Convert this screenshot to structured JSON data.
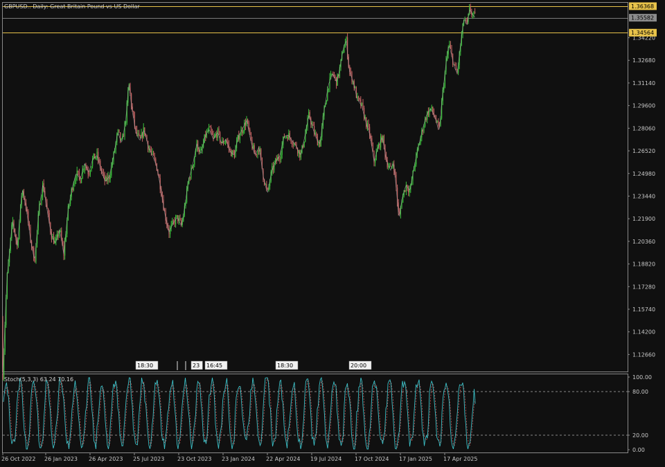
{
  "header": {
    "title": "GBPUSD.. Daily:  Great Britain Pound vs US Dollar"
  },
  "price_panel": {
    "hlines": [
      {
        "label": "1.36368",
        "value": 1.36368,
        "color": "#e8c34a",
        "label_bg": "#e8c34a",
        "label_fg": "#000000"
      },
      {
        "label": "1.35582",
        "value": 1.35582,
        "color": "#7a7a7a",
        "label_bg": "#8c8c8c",
        "label_fg": "#000000"
      },
      {
        "label": "1.34564",
        "value": 1.34564,
        "color": "#e8c34a",
        "label_bg": "#e8c34a",
        "label_fg": "#000000"
      }
    ],
    "y_ticks": [
      "1.34220",
      "1.32680",
      "1.31140",
      "1.29600",
      "1.28060",
      "1.26520",
      "1.24980",
      "1.23440",
      "1.21900",
      "1.20360",
      "1.18820",
      "1.17280",
      "1.15740",
      "1.14200",
      "1.12660"
    ],
    "event_markers": [
      "18:30",
      "",
      "",
      "23",
      "16:45",
      "18:30",
      "20:00"
    ],
    "colors": {
      "up": "#3cc43c",
      "down": "#c86464",
      "ma": "#b0b0b0",
      "background": "#101010",
      "grid": "#808080"
    }
  },
  "stoch_panel": {
    "label": "Stoch(5,3,3) 63.24 70.16",
    "y_ticks": [
      "100.00",
      "80.00",
      "20.00",
      "0.00"
    ],
    "levels": [
      80,
      20
    ],
    "colors": {
      "main": "#3bbfc6",
      "signal": "#d05a5a"
    }
  },
  "x_axis": {
    "ticks": [
      "26 Oct 2022",
      "26 Jan 2023",
      "26 Apr 2023",
      "25 Jul 2023",
      "23 Oct 2023",
      "23 Jan 2024",
      "22 Apr 2024",
      "19 Jul 2024",
      "17 Oct 2024",
      "17 Jan 2025",
      "17 Apr 2025"
    ]
  },
  "chart_data": {
    "type": "candlestick",
    "title": "GBPUSD.. Daily:  Great Britain Pound vs US Dollar",
    "ylim": [
      1.115,
      1.366
    ],
    "x_range": [
      "26 Oct 2022",
      "Jun 2025"
    ],
    "close_path": [
      [
        0,
        1.15
      ],
      [
        4,
        1.113
      ],
      [
        10,
        1.178
      ],
      [
        18,
        1.218
      ],
      [
        25,
        1.2
      ],
      [
        32,
        1.24
      ],
      [
        38,
        1.226
      ],
      [
        44,
        1.205
      ],
      [
        50,
        1.19
      ],
      [
        56,
        1.224
      ],
      [
        62,
        1.243
      ],
      [
        68,
        1.225
      ],
      [
        74,
        1.208
      ],
      [
        80,
        1.202
      ],
      [
        86,
        1.212
      ],
      [
        92,
        1.195
      ],
      [
        98,
        1.224
      ],
      [
        104,
        1.24
      ],
      [
        110,
        1.25
      ],
      [
        116,
        1.246
      ],
      [
        122,
        1.257
      ],
      [
        128,
        1.25
      ],
      [
        134,
        1.26
      ],
      [
        140,
        1.262
      ],
      [
        146,
        1.252
      ],
      [
        152,
        1.244
      ],
      [
        158,
        1.248
      ],
      [
        164,
        1.262
      ],
      [
        170,
        1.278
      ],
      [
        176,
        1.27
      ],
      [
        182,
        1.288
      ],
      [
        186,
        1.312
      ],
      [
        190,
        1.295
      ],
      [
        196,
        1.278
      ],
      [
        202,
        1.272
      ],
      [
        208,
        1.28
      ],
      [
        214,
        1.268
      ],
      [
        220,
        1.262
      ],
      [
        226,
        1.255
      ],
      [
        232,
        1.24
      ],
      [
        238,
        1.222
      ],
      [
        244,
        1.21
      ],
      [
        250,
        1.216
      ],
      [
        256,
        1.22
      ],
      [
        262,
        1.214
      ],
      [
        266,
        1.225
      ],
      [
        272,
        1.245
      ],
      [
        278,
        1.255
      ],
      [
        284,
        1.27
      ],
      [
        290,
        1.263
      ],
      [
        296,
        1.275
      ],
      [
        302,
        1.28
      ],
      [
        308,
        1.273
      ],
      [
        314,
        1.278
      ],
      [
        320,
        1.27
      ],
      [
        326,
        1.273
      ],
      [
        332,
        1.265
      ],
      [
        338,
        1.262
      ],
      [
        344,
        1.275
      ],
      [
        350,
        1.28
      ],
      [
        356,
        1.286
      ],
      [
        362,
        1.272
      ],
      [
        368,
        1.262
      ],
      [
        374,
        1.268
      ],
      [
        380,
        1.248
      ],
      [
        386,
        1.236
      ],
      [
        392,
        1.251
      ],
      [
        398,
        1.258
      ],
      [
        404,
        1.262
      ],
      [
        410,
        1.275
      ],
      [
        416,
        1.276
      ],
      [
        422,
        1.272
      ],
      [
        428,
        1.268
      ],
      [
        434,
        1.262
      ],
      [
        440,
        1.275
      ],
      [
        446,
        1.29
      ],
      [
        452,
        1.28
      ],
      [
        458,
        1.272
      ],
      [
        462,
        1.27
      ],
      [
        468,
        1.293
      ],
      [
        474,
        1.31
      ],
      [
        480,
        1.318
      ],
      [
        486,
        1.312
      ],
      [
        490,
        1.32
      ],
      [
        496,
        1.336
      ],
      [
        500,
        1.34
      ],
      [
        504,
        1.32
      ],
      [
        510,
        1.312
      ],
      [
        516,
        1.3
      ],
      [
        522,
        1.296
      ],
      [
        528,
        1.285
      ],
      [
        534,
        1.276
      ],
      [
        540,
        1.258
      ],
      [
        546,
        1.268
      ],
      [
        552,
        1.275
      ],
      [
        558,
        1.258
      ],
      [
        564,
        1.252
      ],
      [
        568,
        1.258
      ],
      [
        572,
        1.24
      ],
      [
        576,
        1.218
      ],
      [
        580,
        1.232
      ],
      [
        586,
        1.242
      ],
      [
        592,
        1.238
      ],
      [
        598,
        1.255
      ],
      [
        604,
        1.268
      ],
      [
        610,
        1.28
      ],
      [
        616,
        1.29
      ],
      [
        622,
        1.294
      ],
      [
        628,
        1.288
      ],
      [
        634,
        1.278
      ],
      [
        638,
        1.3
      ],
      [
        644,
        1.325
      ],
      [
        648,
        1.338
      ],
      [
        652,
        1.33
      ],
      [
        656,
        1.322
      ],
      [
        660,
        1.318
      ],
      [
        666,
        1.342
      ],
      [
        670,
        1.356
      ],
      [
        674,
        1.35
      ],
      [
        678,
        1.362
      ],
      [
        682,
        1.358
      ],
      [
        686,
        1.356
      ]
    ],
    "stochastic": {
      "name": "Stoch(5,3,3)",
      "main": 63.24,
      "signal": 70.16,
      "levels": [
        80,
        20
      ],
      "ylim": [
        0,
        100
      ]
    }
  }
}
